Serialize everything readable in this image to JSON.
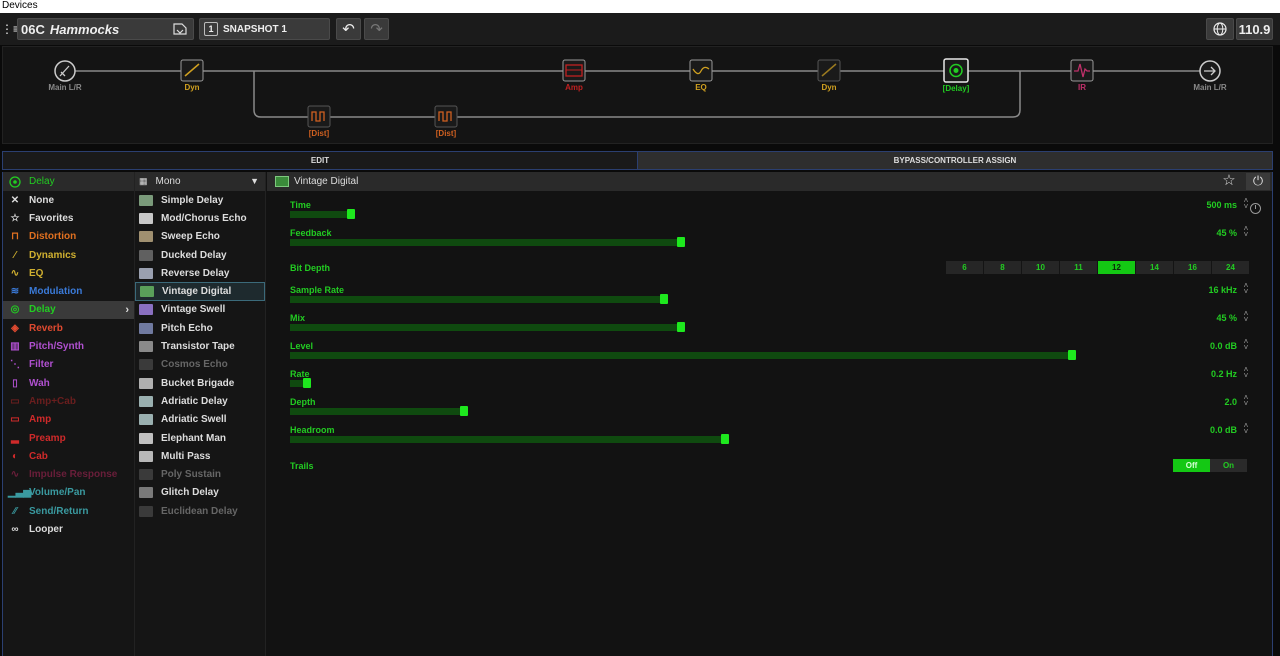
{
  "window": {
    "title": "Devices"
  },
  "toolbar": {
    "preset_number": "06C",
    "preset_name": "Hammocks",
    "snapshot_number": "1",
    "snapshot_label": "SNAPSHOT 1",
    "tempo": "110.9"
  },
  "flow": {
    "blocks": [
      {
        "label": "Main L/R",
        "color": "#888888"
      },
      {
        "label": "Dyn",
        "color": "#d0a020"
      },
      {
        "label": "[Dist]",
        "color": "#d06020"
      },
      {
        "label": "[Dist]",
        "color": "#d06020"
      },
      {
        "label": "Amp",
        "color": "#c02020"
      },
      {
        "label": "EQ",
        "color": "#d0a020"
      },
      {
        "label": "Dyn",
        "color": "#d0a020"
      },
      {
        "label": "[Delay]",
        "color": "#22cc22"
      },
      {
        "label": "IR",
        "color": "#c0306a"
      },
      {
        "label": "Main L/R",
        "color": "#888888"
      }
    ]
  },
  "tabs": {
    "edit": "EDIT",
    "bypass": "BYPASS/CONTROLLER ASSIGN"
  },
  "categories": {
    "header": "Delay",
    "items": [
      {
        "label": "None",
        "color": "#dddddd",
        "icon": "x-icon"
      },
      {
        "label": "Favorites",
        "color": "#dddddd",
        "icon": "star-icon"
      },
      {
        "label": "Distortion",
        "color": "#e07020",
        "icon": "distortion-icon"
      },
      {
        "label": "Dynamics",
        "color": "#d0b030",
        "icon": "dynamics-icon"
      },
      {
        "label": "EQ",
        "color": "#d0b030",
        "icon": "eq-icon"
      },
      {
        "label": "Modulation",
        "color": "#3a7ad8",
        "icon": "modulation-icon"
      },
      {
        "label": "Delay",
        "color": "#22cc22",
        "icon": "delay-icon"
      },
      {
        "label": "Reverb",
        "color": "#e04a30",
        "icon": "reverb-icon"
      },
      {
        "label": "Pitch/Synth",
        "color": "#b050d0",
        "icon": "pitch-icon"
      },
      {
        "label": "Filter",
        "color": "#b050d0",
        "icon": "filter-icon"
      },
      {
        "label": "Wah",
        "color": "#b050d0",
        "icon": "wah-icon"
      },
      {
        "label": "Amp+Cab",
        "color": "#6a1e1e",
        "icon": "ampcab-icon"
      },
      {
        "label": "Amp",
        "color": "#d02a2a",
        "icon": "amp-icon"
      },
      {
        "label": "Preamp",
        "color": "#d02a2a",
        "icon": "preamp-icon"
      },
      {
        "label": "Cab",
        "color": "#d02a2a",
        "icon": "cab-icon"
      },
      {
        "label": "Impulse Response",
        "color": "#6a1e3a",
        "icon": "ir-icon"
      },
      {
        "label": "Volume/Pan",
        "color": "#3a9aa0",
        "icon": "volume-icon"
      },
      {
        "label": "Send/Return",
        "color": "#3a9aa0",
        "icon": "send-return-icon"
      },
      {
        "label": "Looper",
        "color": "#dddddd",
        "icon": "looper-icon"
      }
    ]
  },
  "models": {
    "header": "Mono",
    "items": [
      {
        "label": "Simple Delay",
        "icon_color": "#7a9a7a"
      },
      {
        "label": "Mod/Chorus Echo",
        "icon_color": "#c8c8c8"
      },
      {
        "label": "Sweep Echo",
        "icon_color": "#a09070"
      },
      {
        "label": "Ducked Delay",
        "icon_color": "#606060"
      },
      {
        "label": "Reverse Delay",
        "icon_color": "#9aa0b0"
      },
      {
        "label": "Vintage Digital",
        "icon_color": "#5aa05a"
      },
      {
        "label": "Vintage Swell",
        "icon_color": "#8a70c0"
      },
      {
        "label": "Pitch Echo",
        "icon_color": "#707aa0"
      },
      {
        "label": "Transistor Tape",
        "icon_color": "#8a8a8a"
      },
      {
        "label": "Cosmos Echo",
        "icon_color": "#3a3a3a"
      },
      {
        "label": "Bucket Brigade",
        "icon_color": "#b0b0b0"
      },
      {
        "label": "Adriatic Delay",
        "icon_color": "#9ab0b0"
      },
      {
        "label": "Adriatic Swell",
        "icon_color": "#9ab0b0"
      },
      {
        "label": "Elephant Man",
        "icon_color": "#c0c0c0"
      },
      {
        "label": "Multi Pass",
        "icon_color": "#b8b8b8"
      },
      {
        "label": "Poly Sustain",
        "icon_color": "#3a3a3a"
      },
      {
        "label": "Glitch Delay",
        "icon_color": "#7a7a7a"
      },
      {
        "label": "Euclidean Delay",
        "icon_color": "#3a3a3a"
      }
    ],
    "disabled": [
      "Cosmos Echo",
      "Poly Sustain",
      "Euclidean Delay"
    ],
    "selected": "Vintage Digital"
  },
  "params": {
    "block_name": "Vintage Digital",
    "items": [
      {
        "label": "Time",
        "value": "500 ms",
        "level": 0.07
      },
      {
        "label": "Feedback",
        "value": "45 %",
        "level": 0.45
      },
      {
        "label": "Sample Rate",
        "value": "16 kHz",
        "level": 0.43
      },
      {
        "label": "Mix",
        "value": "45 %",
        "level": 0.45
      },
      {
        "label": "Level",
        "value": "0.0 dB",
        "level": 0.9
      },
      {
        "label": "Rate",
        "value": "0.2 Hz",
        "level": 0.02
      },
      {
        "label": "Depth",
        "value": "2.0",
        "level": 0.2
      },
      {
        "label": "Headroom",
        "value": "0.0 dB",
        "level": 0.5
      }
    ],
    "bit_depth": {
      "label": "Bit Depth",
      "options": [
        "6",
        "8",
        "10",
        "11",
        "12",
        "14",
        "16",
        "24"
      ],
      "selected": "12"
    },
    "trails": {
      "label": "Trails",
      "off": "Off",
      "on": "On",
      "selected": "Off"
    }
  }
}
